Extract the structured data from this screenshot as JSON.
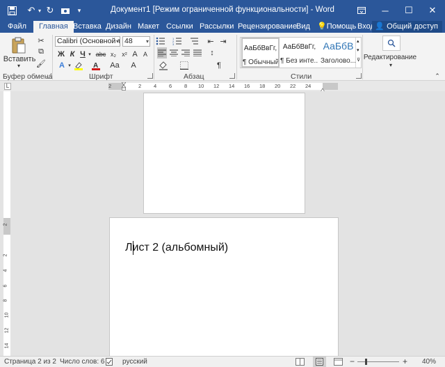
{
  "titlebar": {
    "title": "Документ1 [Режим ограниченной функциональности] - Word",
    "icons": [
      "save-icon",
      "undo-icon",
      "redo-icon",
      "touch-mode-icon",
      "customize-qat-icon"
    ],
    "window_buttons": [
      "ribbon-display-options",
      "minimize",
      "maximize",
      "close"
    ]
  },
  "tabs": {
    "file": "Файл",
    "home": "Главная",
    "insert": "Вставка",
    "design": "Дизайн",
    "layout": "Макет",
    "references": "Ссылки",
    "mailings": "Рассылки",
    "review": "Рецензирование",
    "view": "Вид",
    "tell_me": "Помощь",
    "sign_in": "Вход",
    "share": "Общий доступ"
  },
  "ribbon": {
    "clipboard": {
      "paste": "Вставить",
      "label": "Буфер обмена"
    },
    "font": {
      "font_name": "Calibri (Основной тек",
      "font_size": "48",
      "bold": "Ж",
      "italic": "К",
      "underline": "Ч",
      "label": "Шрифт"
    },
    "paragraph": {
      "label": "Абзац"
    },
    "styles": {
      "label": "Стили",
      "items": [
        {
          "sample": "АаБбВвГг,",
          "name": "¶ Обычный"
        },
        {
          "sample": "АаБбВвГг,",
          "name": "¶ Без инте..."
        },
        {
          "sample": "АаБбВ",
          "name": "Заголово..."
        }
      ]
    },
    "editing": {
      "label": "Редактирование"
    }
  },
  "ruler": {
    "numbers": [
      "2",
      "2",
      "4",
      "6",
      "8",
      "10",
      "12",
      "14",
      "16",
      "18",
      "20",
      "22",
      "24"
    ],
    "vertical_numbers": [
      "2",
      "2",
      "4",
      "6",
      "8",
      "10",
      "12",
      "14"
    ]
  },
  "document": {
    "page2_text": "Лист 2 (альбомный)"
  },
  "statusbar": {
    "page": "Страница 2 из 2",
    "words": "Число слов: 6",
    "language": "русский",
    "zoom": "40%"
  },
  "colors": {
    "accent": "#2b579a",
    "ribbon": "#f3f3f3",
    "canvas": "#e3e3e3"
  }
}
